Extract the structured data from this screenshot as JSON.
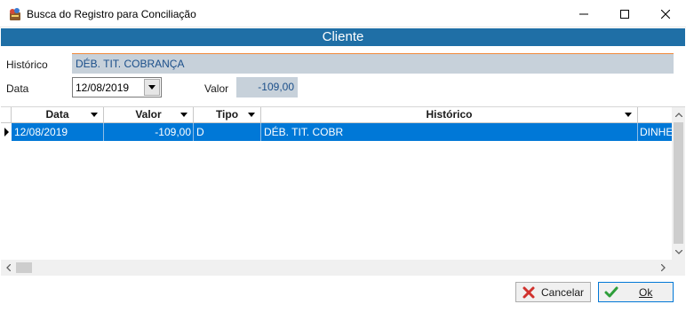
{
  "window": {
    "title": "Busca do Registro para Conciliação",
    "icon": "app-icon",
    "controls": [
      "minimize-icon",
      "maximize-icon",
      "close-icon"
    ]
  },
  "header": {
    "title": "Cliente"
  },
  "form": {
    "historico_label": "Histórico",
    "historico_value": "DÉB. TIT. COBRANÇA",
    "data_label": "Data",
    "data_value": "12/08/2019",
    "valor_label": "Valor",
    "valor_value": "-109,00"
  },
  "grid": {
    "columns": [
      "Data",
      "Valor",
      "Tipo",
      "Histórico"
    ],
    "rows": [
      {
        "data": "12/08/2019",
        "valor": "-109,00",
        "tipo": "D",
        "historico": "DÉB. TIT. COBR",
        "extra": "DINHE"
      }
    ]
  },
  "buttons": {
    "cancel_label": "Cancelar",
    "ok_label": "Ok"
  },
  "colors": {
    "header_band": "#1f6fa6",
    "selection": "#0078d7",
    "readonly_field": "#c7d1da",
    "accent_border": "#f08a3c"
  }
}
